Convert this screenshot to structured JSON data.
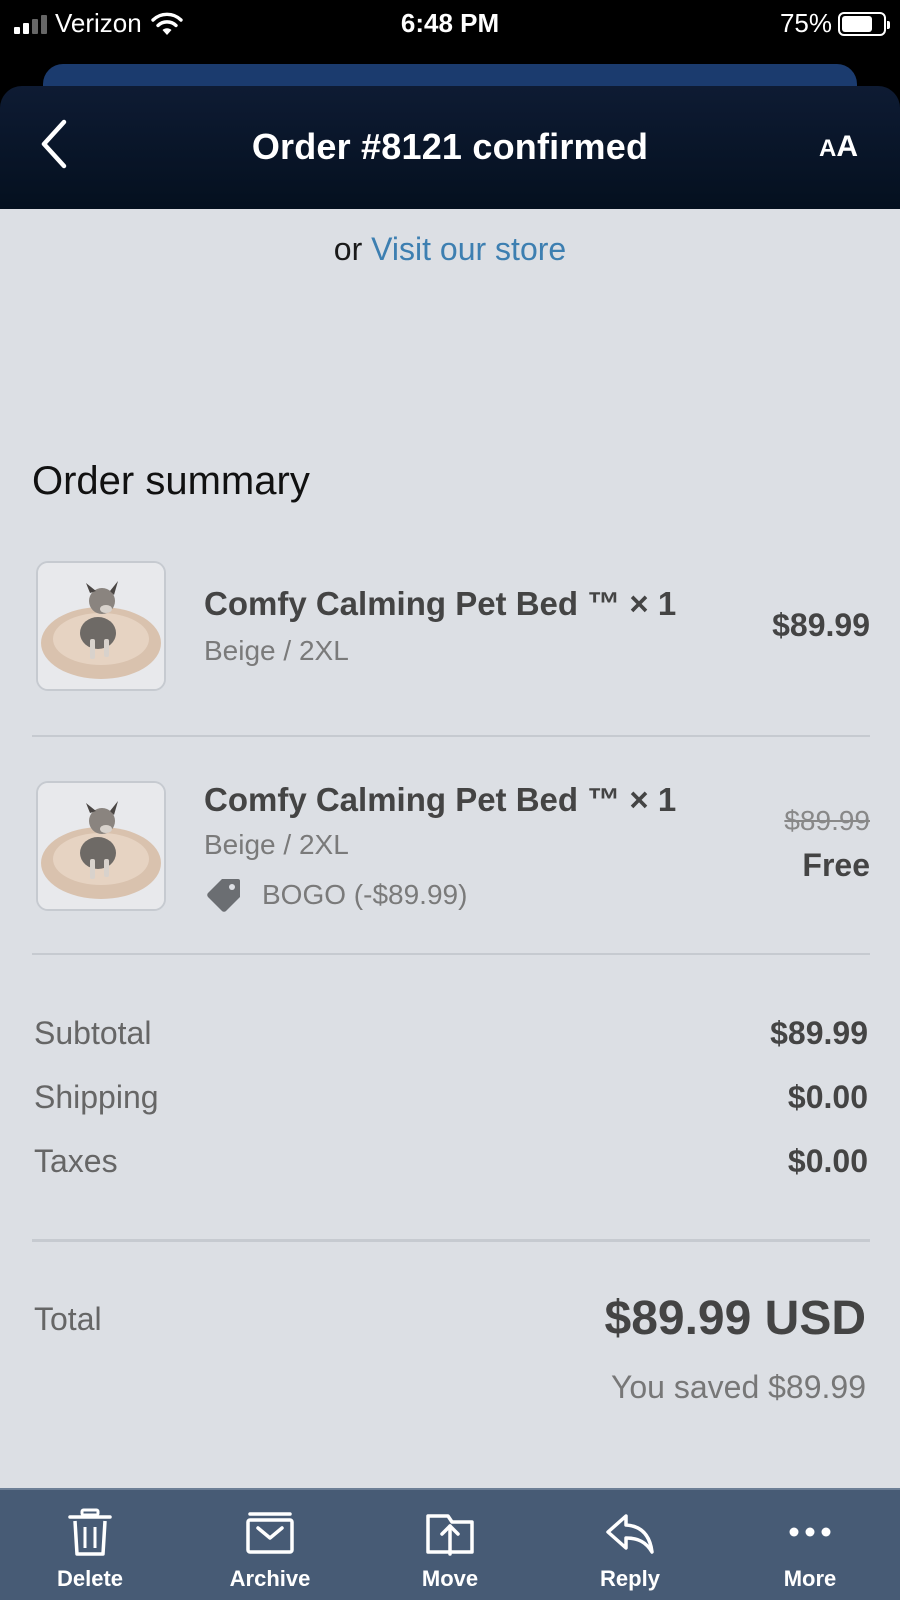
{
  "status_bar": {
    "carrier": "Verizon",
    "time": "6:48 PM",
    "battery": "75%",
    "battery_level": 0.75
  },
  "header": {
    "title": "Order #8121 confirmed",
    "text_size_label_big": "A",
    "text_size_label_small": "A"
  },
  "store": {
    "prefix": "or",
    "link": "Visit our store"
  },
  "summary": {
    "title": "Order summary",
    "items": [
      {
        "name": "Comfy Calming Pet Bed ™ × 1",
        "variant": "Beige / 2XL",
        "price": "$89.99"
      },
      {
        "name": "Comfy Calming Pet Bed ™ × 1",
        "variant": "Beige / 2XL",
        "discount": "BOGO (-$89.99)",
        "original_price": "$89.99",
        "price": "Free"
      }
    ],
    "subtotal_label": "Subtotal",
    "subtotal": "$89.99",
    "shipping_label": "Shipping",
    "shipping": "$0.00",
    "taxes_label": "Taxes",
    "taxes": "$0.00",
    "total_label": "Total",
    "total": "$89.99 USD",
    "saved": "You saved $89.99"
  },
  "toolbar": {
    "delete": "Delete",
    "archive": "Archive",
    "move": "Move",
    "reply": "Reply",
    "more": "More"
  },
  "colors": {
    "header_bg": "#0e1b33",
    "content_bg": "#dcdfe4",
    "link": "#3d7fb1",
    "toolbar_bg": "#475b75"
  }
}
